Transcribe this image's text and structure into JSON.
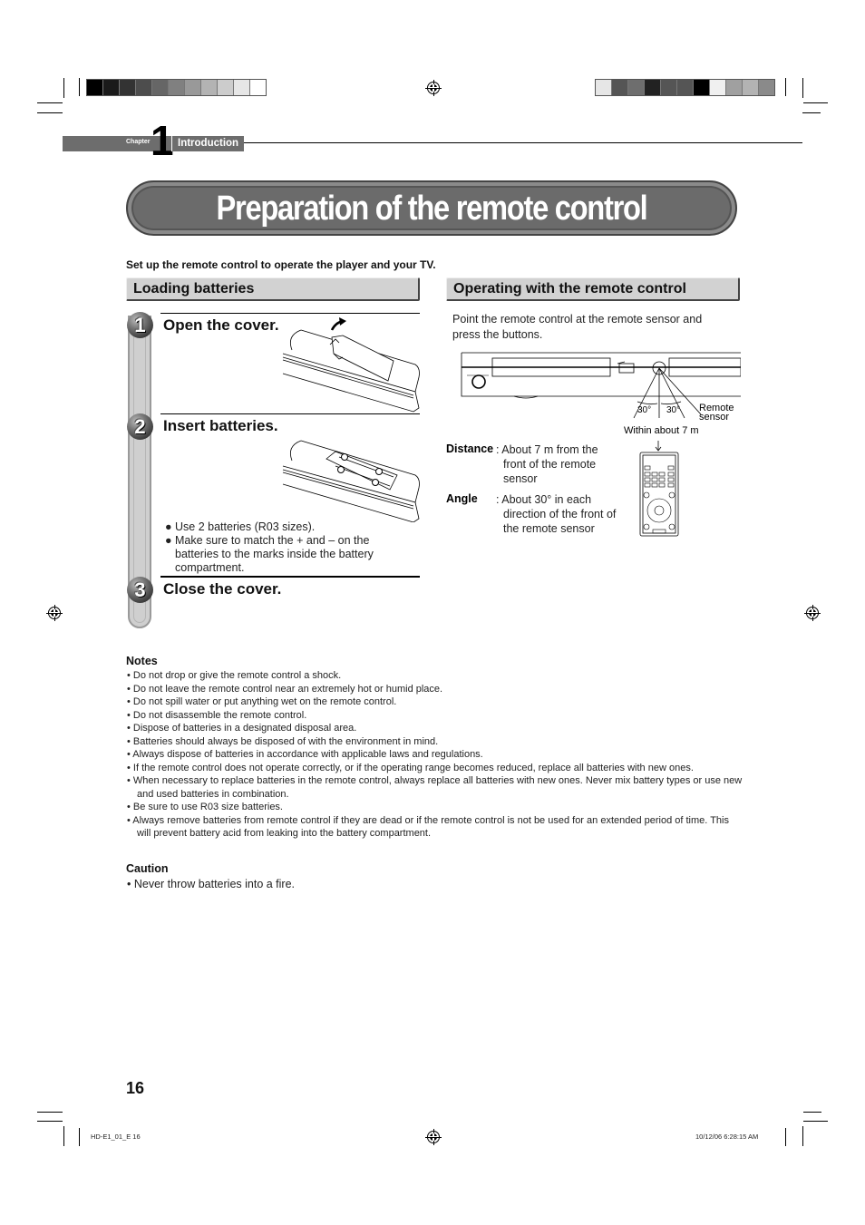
{
  "print_marks": {
    "left_color_bar": [
      "#000000",
      "#1a1a1a",
      "#333333",
      "#4d4d4d",
      "#666666",
      "#808080",
      "#999999",
      "#b3b3b3",
      "#cccccc",
      "#e6e6e6",
      "#ffffff"
    ],
    "right_color_bar": [
      "#e6e6e6",
      "#555555",
      "#6e6e6e",
      "#222222",
      "#555555",
      "#555555",
      "#000000",
      "#f0f0f0",
      "#a0a0a0",
      "#b3b3b3",
      "#8a8a8a"
    ]
  },
  "chapter": {
    "label": "Chapter",
    "number": "1",
    "title": "Introduction"
  },
  "page_title": "Preparation of the remote control",
  "intro": "Set up the remote control to operate the player and your TV.",
  "loading": {
    "heading": "Loading batteries",
    "steps": [
      {
        "num": "1",
        "title": "Open the cover."
      },
      {
        "num": "2",
        "title": "Insert batteries."
      },
      {
        "num": "3",
        "title": "Close the cover."
      }
    ],
    "bullets": [
      "● Use 2 batteries (R03 sizes).",
      "● Make sure to match the + and – on the batteries to the marks inside the battery compartment."
    ]
  },
  "operating": {
    "heading": "Operating with the remote control",
    "text": "Point the remote control at the remote sensor and press the buttons.",
    "diagram": {
      "angle_left": "30°",
      "angle_right": "30°",
      "sensor_label_1": "Remote",
      "sensor_label_2": "sensor",
      "range_label": "Within about 7 m"
    },
    "distance_label": "Distance",
    "distance_value": ": About 7 m from the front of the remote sensor",
    "angle_label": "Angle",
    "angle_value": ": About 30° in each direction of the front of the remote sensor"
  },
  "notes": {
    "heading": "Notes",
    "items": [
      "• Do not drop or give the remote control a shock.",
      "• Do not leave the remote control near an extremely hot or humid place.",
      "• Do not spill water or put anything wet on the remote control.",
      "• Do not disassemble the remote control.",
      "• Dispose of batteries in a designated disposal area.",
      "• Batteries should always be disposed of with the environment in mind.",
      "• Always dispose of batteries in accordance with applicable laws and regulations.",
      "• If the remote control does not operate correctly, or if the operating range becomes reduced, replace all batteries with new ones.",
      "• When necessary to replace batteries in the remote control, always replace all batteries with new ones. Never mix battery types or use new and used batteries in combination.",
      "• Be sure to use R03 size batteries.",
      "• Always remove batteries from remote control if they are dead or if the remote control is not be used for an extended period of time. This will prevent battery acid from leaking into the battery compartment."
    ]
  },
  "caution": {
    "heading": "Caution",
    "items": [
      "• Never throw batteries into a fire."
    ]
  },
  "footer": {
    "page_number": "16",
    "slug_left": "HD-E1_01_E  16",
    "slug_right": "10/12/06  6:28:15 AM"
  }
}
